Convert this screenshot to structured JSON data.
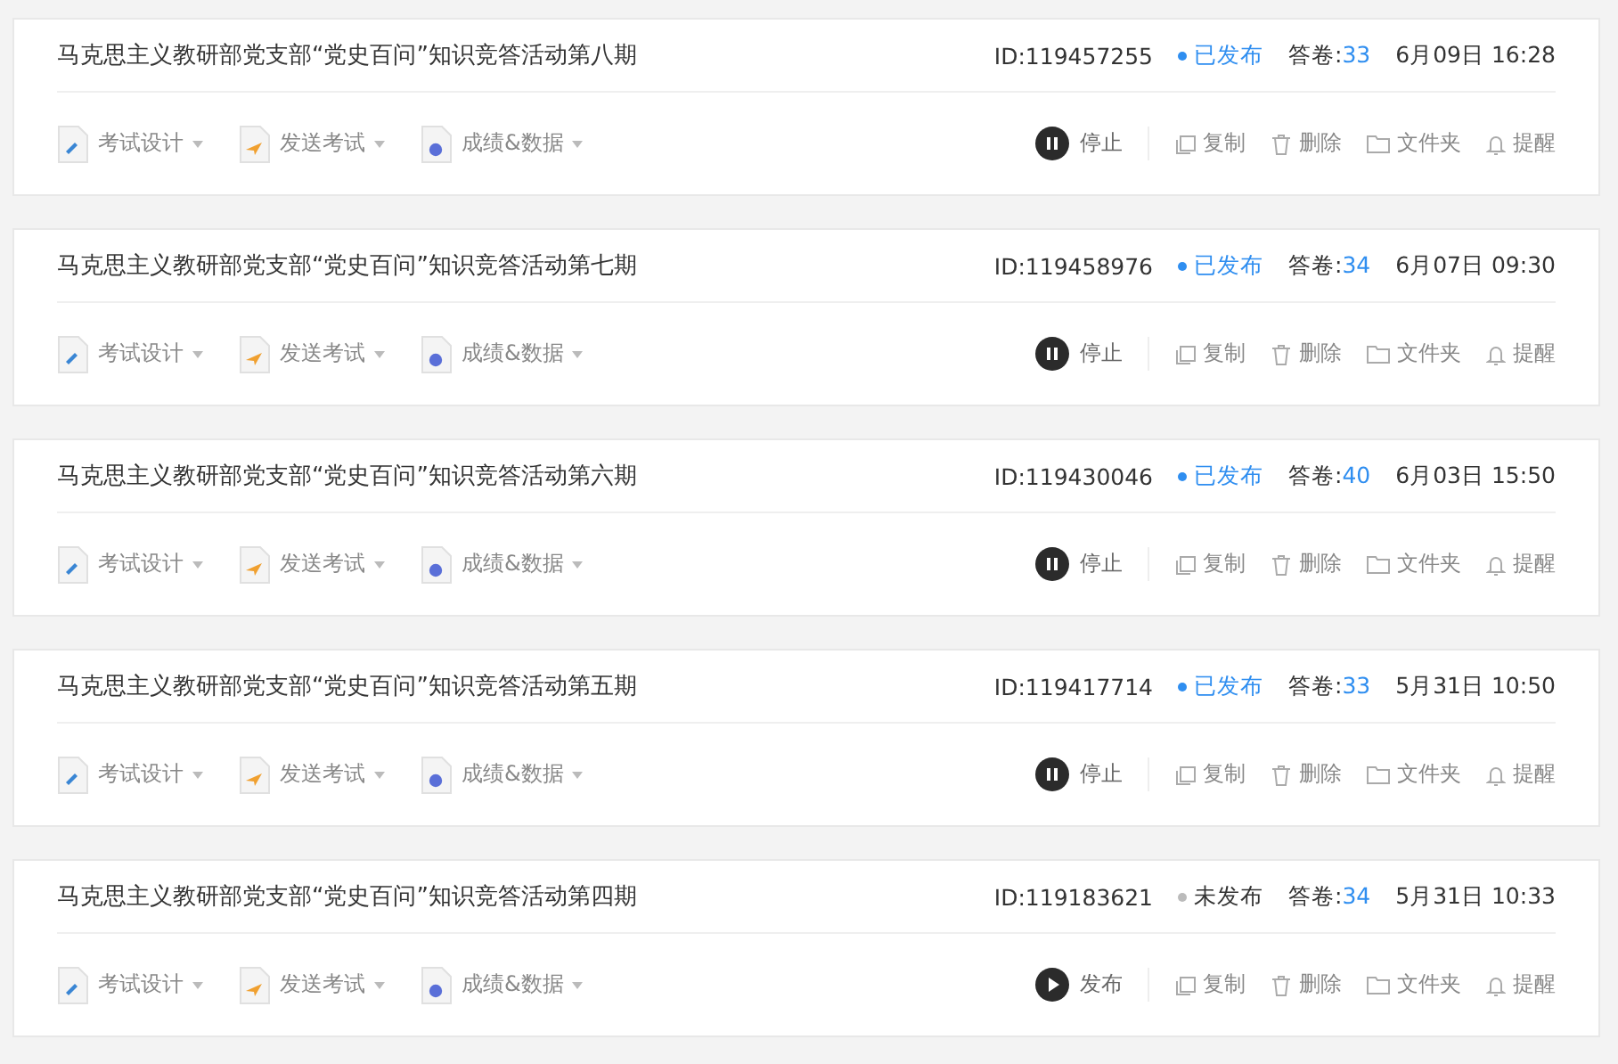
{
  "exams": [
    {
      "title": "马克思主义教研部党支部“党史百问”知识竞答活动第八期",
      "id": "ID:119457255",
      "status": "已发布",
      "published": true,
      "answers_label": "答卷:",
      "answers": "33",
      "date": "6月09日 16:28",
      "menus": [
        {
          "kind": "design",
          "label": "考试设计"
        },
        {
          "kind": "send",
          "label": "发送考试"
        },
        {
          "kind": "data",
          "label": "成绩&数据"
        }
      ],
      "toggle": "停止",
      "actions": [
        {
          "kind": "copy",
          "label": "复制"
        },
        {
          "kind": "delete",
          "label": "删除"
        },
        {
          "kind": "folder",
          "label": "文件夹"
        },
        {
          "kind": "remind",
          "label": "提醒"
        }
      ]
    },
    {
      "title": "马克思主义教研部党支部“党史百问”知识竞答活动第七期",
      "id": "ID:119458976",
      "status": "已发布",
      "published": true,
      "answers_label": "答卷:",
      "answers": "34",
      "date": "6月07日 09:30",
      "menus": [
        {
          "kind": "design",
          "label": "考试设计"
        },
        {
          "kind": "send",
          "label": "发送考试"
        },
        {
          "kind": "data",
          "label": "成绩&数据"
        }
      ],
      "toggle": "停止",
      "actions": [
        {
          "kind": "copy",
          "label": "复制"
        },
        {
          "kind": "delete",
          "label": "删除"
        },
        {
          "kind": "folder",
          "label": "文件夹"
        },
        {
          "kind": "remind",
          "label": "提醒"
        }
      ]
    },
    {
      "title": "马克思主义教研部党支部“党史百问”知识竞答活动第六期",
      "id": "ID:119430046",
      "status": "已发布",
      "published": true,
      "answers_label": "答卷:",
      "answers": "40",
      "date": "6月03日 15:50",
      "menus": [
        {
          "kind": "design",
          "label": "考试设计"
        },
        {
          "kind": "send",
          "label": "发送考试"
        },
        {
          "kind": "data",
          "label": "成绩&数据"
        }
      ],
      "toggle": "停止",
      "actions": [
        {
          "kind": "copy",
          "label": "复制"
        },
        {
          "kind": "delete",
          "label": "删除"
        },
        {
          "kind": "folder",
          "label": "文件夹"
        },
        {
          "kind": "remind",
          "label": "提醒"
        }
      ]
    },
    {
      "title": "马克思主义教研部党支部“党史百问”知识竞答活动第五期",
      "id": "ID:119417714",
      "status": "已发布",
      "published": true,
      "answers_label": "答卷:",
      "answers": "33",
      "date": "5月31日 10:50",
      "menus": [
        {
          "kind": "design",
          "label": "考试设计"
        },
        {
          "kind": "send",
          "label": "发送考试"
        },
        {
          "kind": "data",
          "label": "成绩&数据"
        }
      ],
      "toggle": "停止",
      "actions": [
        {
          "kind": "copy",
          "label": "复制"
        },
        {
          "kind": "delete",
          "label": "删除"
        },
        {
          "kind": "folder",
          "label": "文件夹"
        },
        {
          "kind": "remind",
          "label": "提醒"
        }
      ]
    },
    {
      "title": "马克思主义教研部党支部“党史百问”知识竞答活动第四期",
      "id": "ID:119183621",
      "status": "未发布",
      "published": false,
      "answers_label": "答卷:",
      "answers": "34",
      "date": "5月31日 10:33",
      "menus": [
        {
          "kind": "design",
          "label": "考试设计"
        },
        {
          "kind": "send",
          "label": "发送考试"
        },
        {
          "kind": "data",
          "label": "成绩&数据"
        }
      ],
      "toggle": "发布",
      "actions": [
        {
          "kind": "copy",
          "label": "复制"
        },
        {
          "kind": "delete",
          "label": "删除"
        },
        {
          "kind": "folder",
          "label": "文件夹"
        },
        {
          "kind": "remind",
          "label": "提醒"
        }
      ]
    }
  ]
}
